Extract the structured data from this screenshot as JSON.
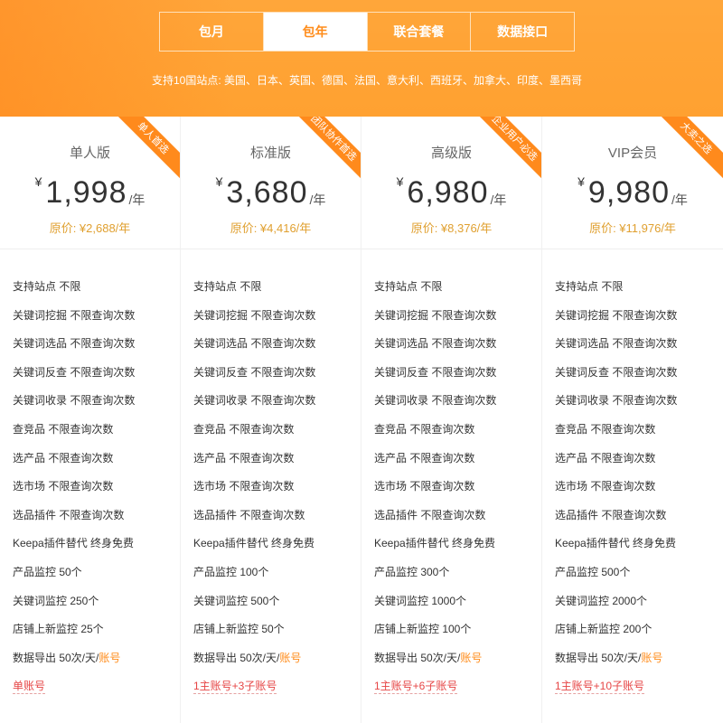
{
  "tabs": [
    {
      "label": "包月",
      "active": false
    },
    {
      "label": "包年",
      "active": true
    },
    {
      "label": "联合套餐",
      "active": false
    },
    {
      "label": "数据接口",
      "active": false
    }
  ],
  "sites_text": "支持10国站点: 美国、日本、英国、德国、法国、意大利、西班牙、加拿大、印度、墨西哥",
  "colors": {
    "accent": "#ff9f2d",
    "ribbon": "#ff8a1c",
    "original_price": "#e0a030",
    "account": "#e64545"
  },
  "plans": [
    {
      "name": "单人版",
      "ribbon": "单人首选",
      "currency": "¥",
      "price": "1,998",
      "per": "/年",
      "original": "原价: ¥2,688/年",
      "features": [
        "支持站点 不限",
        "关键词挖掘 不限查询次数",
        "关键词选品 不限查询次数",
        "关键词反查 不限查询次数",
        "关键词收录 不限查询次数",
        "查竞品 不限查询次数",
        "选产品 不限查询次数",
        "选市场 不限查询次数",
        "选品插件 不限查询次数",
        "Keepa插件替代 终身免费",
        "产品监控 50个",
        "关键词监控 250个",
        "店铺上新监控 25个"
      ],
      "export_prefix": "数据导出 50次/天/",
      "export_tag": "账号",
      "accounts": "单账号"
    },
    {
      "name": "标准版",
      "ribbon": "团队协作首选",
      "currency": "¥",
      "price": "3,680",
      "per": "/年",
      "original": "原价: ¥4,416/年",
      "features": [
        "支持站点 不限",
        "关键词挖掘 不限查询次数",
        "关键词选品 不限查询次数",
        "关键词反查 不限查询次数",
        "关键词收录 不限查询次数",
        "查竞品 不限查询次数",
        "选产品 不限查询次数",
        "选市场 不限查询次数",
        "选品插件 不限查询次数",
        "Keepa插件替代 终身免费",
        "产品监控 100个",
        "关键词监控 500个",
        "店铺上新监控 50个"
      ],
      "export_prefix": "数据导出 50次/天/",
      "export_tag": "账号",
      "accounts": "1主账号+3子账号"
    },
    {
      "name": "高级版",
      "ribbon": "企业用户必选",
      "currency": "¥",
      "price": "6,980",
      "per": "/年",
      "original": "原价: ¥8,376/年",
      "features": [
        "支持站点 不限",
        "关键词挖掘 不限查询次数",
        "关键词选品 不限查询次数",
        "关键词反查 不限查询次数",
        "关键词收录 不限查询次数",
        "查竞品 不限查询次数",
        "选产品 不限查询次数",
        "选市场 不限查询次数",
        "选品插件 不限查询次数",
        "Keepa插件替代 终身免费",
        "产品监控 300个",
        "关键词监控 1000个",
        "店铺上新监控 100个"
      ],
      "export_prefix": "数据导出 50次/天/",
      "export_tag": "账号",
      "accounts": "1主账号+6子账号"
    },
    {
      "name": "VIP会员",
      "ribbon": "大卖之选",
      "currency": "¥",
      "price": "9,980",
      "per": "/年",
      "original": "原价: ¥11,976/年",
      "features": [
        "支持站点 不限",
        "关键词挖掘 不限查询次数",
        "关键词选品 不限查询次数",
        "关键词反查 不限查询次数",
        "关键词收录 不限查询次数",
        "查竞品 不限查询次数",
        "选产品 不限查询次数",
        "选市场 不限查询次数",
        "选品插件 不限查询次数",
        "Keepa插件替代 终身免费",
        "产品监控 500个",
        "关键词监控 2000个",
        "店铺上新监控 200个"
      ],
      "export_prefix": "数据导出 50次/天/",
      "export_tag": "账号",
      "accounts": "1主账号+10子账号"
    }
  ]
}
